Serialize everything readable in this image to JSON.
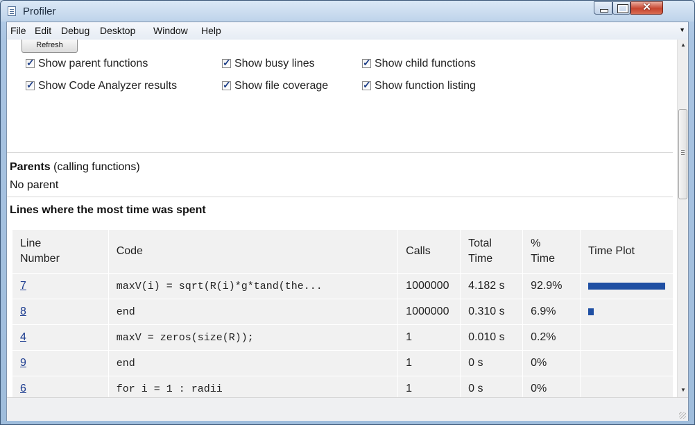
{
  "window": {
    "title": "Profiler"
  },
  "menu": [
    "File",
    "Edit",
    "Debug",
    "Desktop",
    "Window",
    "Help"
  ],
  "toolbar": {
    "refresh_label": "Refresh"
  },
  "options": [
    {
      "label": "Show parent functions",
      "checked": true
    },
    {
      "label": "Show busy lines",
      "checked": true
    },
    {
      "label": "Show child functions",
      "checked": true
    },
    {
      "label": "Show Code Analyzer results",
      "checked": true
    },
    {
      "label": "Show file coverage",
      "checked": true
    },
    {
      "label": "Show function listing",
      "checked": true
    }
  ],
  "parents": {
    "title": "Parents",
    "subtitle": "(calling functions)",
    "value": "No parent"
  },
  "busy_lines": {
    "title": "Lines where the most time was spent",
    "headers": [
      "Line Number",
      "Code",
      "Calls",
      "Total Time",
      "% Time",
      "Time Plot"
    ],
    "rows": [
      {
        "line": "7",
        "code": "maxV(i) = sqrt(R(i)*g*tand(the...",
        "calls": "1000000",
        "total": "4.182 s",
        "pct": "92.9%",
        "plot_fraction": 0.929
      },
      {
        "line": "8",
        "code": "end",
        "calls": "1000000",
        "total": "0.310 s",
        "pct": "6.9%",
        "plot_fraction": 0.069
      },
      {
        "line": "4",
        "code": "maxV = zeros(size(R));",
        "calls": "1",
        "total": "0.010 s",
        "pct": "0.2%",
        "plot_fraction": 0.002
      },
      {
        "line": "9",
        "code": "end",
        "calls": "1",
        "total": "0 s",
        "pct": "0%",
        "plot_fraction": 0
      },
      {
        "line": "6",
        "code": "for i = 1 : radii",
        "calls": "1",
        "total": "0 s",
        "pct": "0%",
        "plot_fraction": 0
      }
    ]
  },
  "colors": {
    "bar": "#1f4fa3",
    "link": "#1b3b8f"
  }
}
